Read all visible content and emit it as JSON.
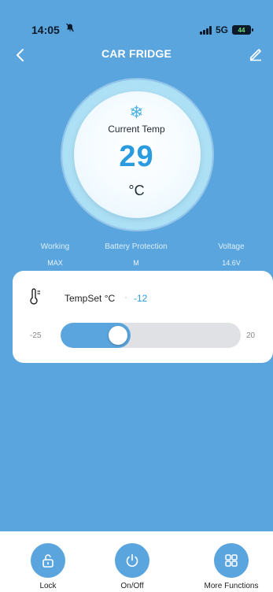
{
  "status_bar": {
    "time": "14:05",
    "network": "5G",
    "battery": "44"
  },
  "header": {
    "title": "CAR FRIDGE"
  },
  "dial": {
    "label": "Current Temp",
    "value": "29",
    "unit": "°C"
  },
  "info": [
    {
      "label": "Working",
      "value": "MAX"
    },
    {
      "label": "Battery Protection",
      "value": "M"
    },
    {
      "label": "Voltage",
      "value": "14.6V"
    }
  ],
  "tempset": {
    "label": "TempSet °C",
    "value": "-12",
    "min": "-25",
    "max": "20",
    "current": -12,
    "min_num": -25,
    "max_num": 20
  },
  "actions": [
    {
      "label": "Lock",
      "icon": "lock-icon"
    },
    {
      "label": "On/Off",
      "icon": "power-icon"
    },
    {
      "label": "More Functions",
      "icon": "grid-icon"
    }
  ],
  "colors": {
    "accent": "#5aa5dd",
    "temp_blue": "#2b9be0",
    "track": "#dfe1e5"
  }
}
